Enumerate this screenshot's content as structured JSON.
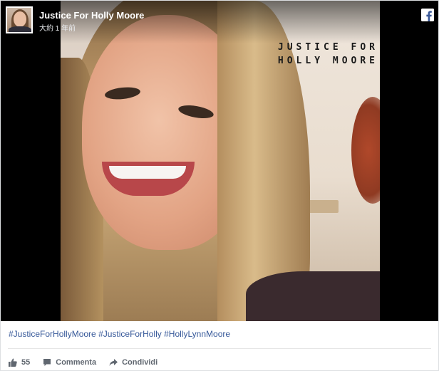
{
  "header": {
    "page_name": "Justice For Holly Moore",
    "timestamp": "大約 1 年前",
    "avatar_icon": "profile-photo",
    "logo_icon": "facebook-icon"
  },
  "image": {
    "overlay_line1": "JUSTICE FOR",
    "overlay_line2": "HOLLY MOORE"
  },
  "hashtags": [
    "#JusticeForHollyMoore",
    "#JusticeForHolly",
    "#HollyLynnMoore"
  ],
  "actions": {
    "like_icon": "thumbs-up-icon",
    "like_count": "55",
    "comment_icon": "comment-icon",
    "comment_label": "Commenta",
    "share_icon": "share-icon",
    "share_label": "Condividi"
  },
  "colors": {
    "link": "#365899",
    "action_text": "#606770",
    "facebook_blue": "#3b5998"
  }
}
